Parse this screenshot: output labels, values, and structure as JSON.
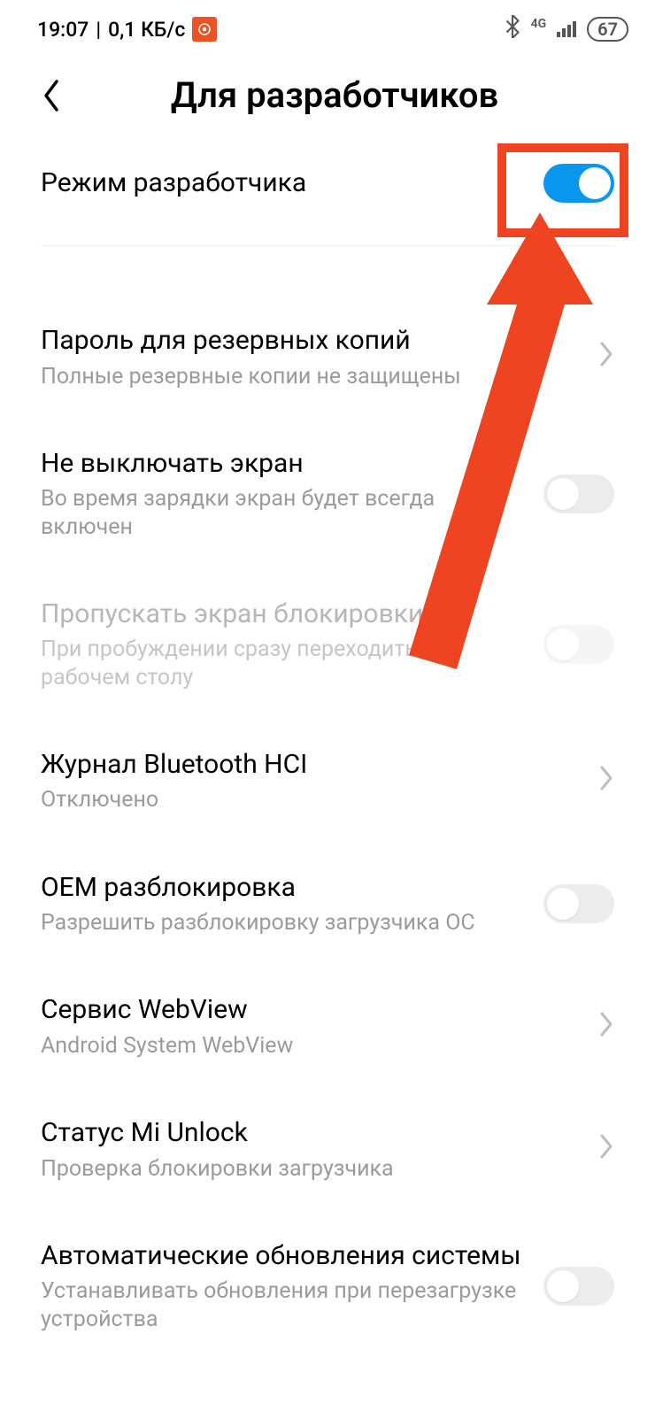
{
  "status": {
    "time": "19:07",
    "speed": "0,1 КБ/с",
    "network": "4G",
    "battery": "67"
  },
  "header": {
    "title": "Для разработчиков"
  },
  "rows": {
    "dev_mode": {
      "title": "Режим разработчика"
    },
    "backup_pw": {
      "title": "Пароль для резервных копий",
      "sub": "Полные резервные копии не защищены"
    },
    "stay_awake": {
      "title": "Не выключать экран",
      "sub": "Во время зарядки экран будет всегда включен"
    },
    "skip_lock": {
      "title": "Пропускать экран блокировки",
      "sub": "При пробуждении сразу переходить к рабочем столу"
    },
    "bt_hci": {
      "title": "Журнал Bluetooth HCI",
      "sub": "Отключено"
    },
    "oem": {
      "title": "OEM разблокировка",
      "sub": "Разрешить разблокировку загрузчика ОС"
    },
    "webview": {
      "title": "Сервис WebView",
      "sub": "Android System WebView"
    },
    "mi_unlock": {
      "title": "Статус Mi Unlock",
      "sub": "Проверка блокировки загрузчика"
    },
    "auto_update": {
      "title": "Автоматические обновления системы",
      "sub": "Устанавливать обновления при перезагрузке устройства"
    }
  }
}
